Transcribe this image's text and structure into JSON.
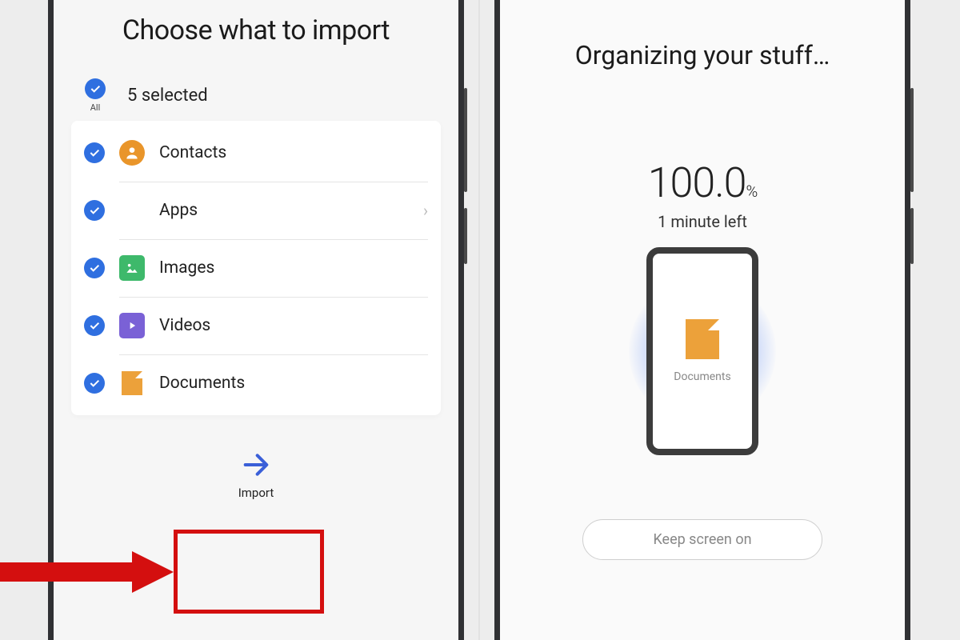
{
  "left": {
    "title": "Choose what to import",
    "allLabel": "All",
    "selectedText": "5 selected",
    "items": [
      {
        "id": "contacts",
        "label": "Contacts",
        "hasChevron": false
      },
      {
        "id": "apps",
        "label": "Apps",
        "hasChevron": true
      },
      {
        "id": "images",
        "label": "Images",
        "hasChevron": false
      },
      {
        "id": "videos",
        "label": "Videos",
        "hasChevron": false
      },
      {
        "id": "documents",
        "label": "Documents",
        "hasChevron": false
      }
    ],
    "importLabel": "Import"
  },
  "right": {
    "title": "Organizing your stuff…",
    "percentValue": "100.0",
    "percentUnit": "%",
    "timeLeft": "1 minute left",
    "currentItemLabel": "Documents",
    "keepScreenLabel": "Keep screen on"
  },
  "colors": {
    "accentBlue": "#2f6fe0",
    "annotationRed": "#d40f0f"
  }
}
